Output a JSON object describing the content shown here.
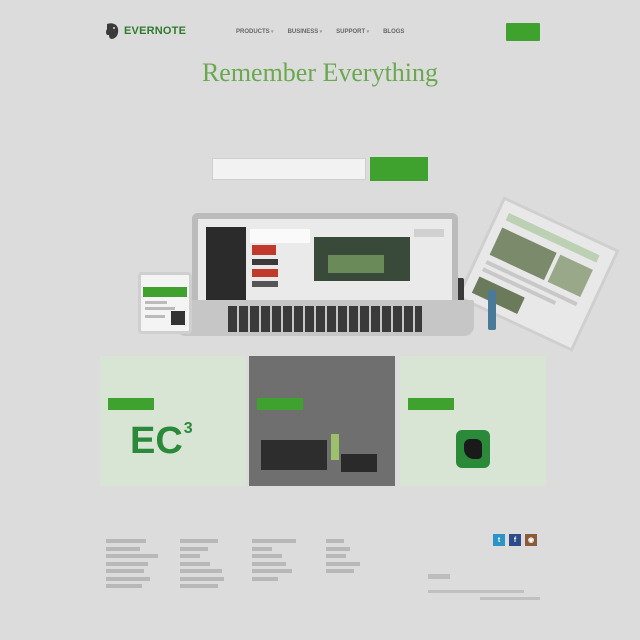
{
  "header": {
    "logo_text": "EVERNOTE",
    "nav": [
      {
        "label": "PRODUCTS",
        "dropdown": true
      },
      {
        "label": "BUSINESS",
        "dropdown": true
      },
      {
        "label": "SUPPORT",
        "dropdown": true
      },
      {
        "label": "BLOGS",
        "dropdown": false
      }
    ],
    "sign_in": "",
    "help": "",
    "signup_button": ""
  },
  "hero": {
    "title": "Remember Everything",
    "subtitle": "",
    "signup_label": "",
    "email_placeholder": "",
    "signup_button": ""
  },
  "cards": [
    {
      "title": "",
      "button": "",
      "graphic_text": "EC",
      "graphic_sup": "3"
    },
    {
      "title": "",
      "button": ""
    },
    {
      "title": "",
      "button": ""
    }
  ],
  "footer": {
    "columns": [
      {
        "heading": ""
      },
      {
        "heading": ""
      },
      {
        "heading": ""
      },
      {
        "heading": ""
      }
    ],
    "social": [
      {
        "icon": "twitter-icon",
        "glyph": "t"
      },
      {
        "icon": "facebook-icon",
        "glyph": "f"
      },
      {
        "icon": "instagram-icon",
        "glyph": ""
      }
    ]
  },
  "colors": {
    "brand_green": "#3fa22f",
    "title_green": "#6aa84f",
    "background": "#dcdcdc"
  }
}
